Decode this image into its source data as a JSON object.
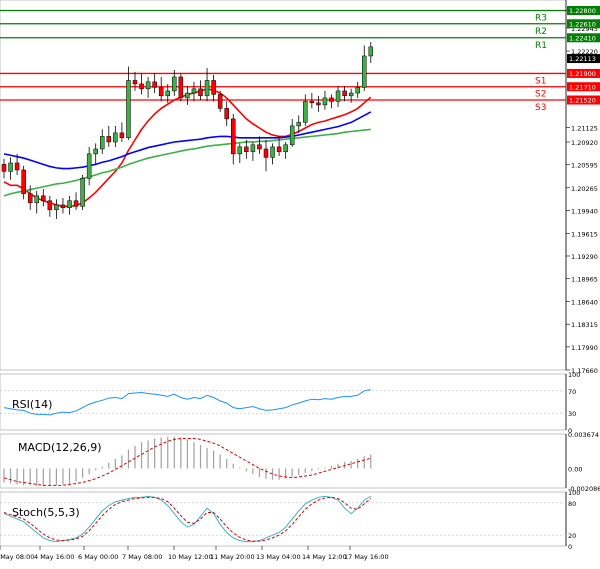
{
  "chart_data": [
    {
      "type": "candlestick",
      "panel": "price",
      "y_axis_ticks": [
        "1.22800",
        "1.22945",
        "1.22220",
        "1.21125",
        "1.20920",
        "1.20595",
        "1.20265",
        "1.19940",
        "1.19615",
        "1.19290",
        "1.18965",
        "1.18640",
        "1.18315",
        "1.17990",
        "1.17660"
      ],
      "y_axis_tick_values": [
        1.228,
        1.2255,
        1.2222,
        1.21125,
        1.2092,
        1.20595,
        1.20265,
        1.1994,
        1.19615,
        1.1929,
        1.18965,
        1.1864,
        1.18315,
        1.1799,
        1.1766
      ],
      "ylim": [
        1.1766,
        1.2295
      ],
      "current_price": "1.22113",
      "current_price_value": 1.22113,
      "levels": [
        {
          "name": "R3",
          "value": 1.228,
          "label": "1.22800",
          "color": "#008000"
        },
        {
          "name": "R2",
          "value": 1.2261,
          "label": "1.22610",
          "color": "#008000"
        },
        {
          "name": "R1",
          "value": 1.2241,
          "label": "1.22410",
          "color": "#008000"
        },
        {
          "name": "S1",
          "value": 1.219,
          "label": "1.21900",
          "color": "#ff0000"
        },
        {
          "name": "S2",
          "value": 1.2171,
          "label": "1.21710",
          "color": "#ff0000"
        },
        {
          "name": "S3",
          "value": 1.2152,
          "label": "1.21520",
          "color": "#ff0000"
        }
      ],
      "x_axis_labels": [
        "3 May 08:00",
        "4 May 16:00",
        "6 May 00:00",
        "7 May 08:00",
        "10 May 12:00",
        "11 May 20:00",
        "13 May 04:00",
        "14 May 12:00",
        "17 May 16:00"
      ],
      "candles": [
        [
          1.206,
          1.2068,
          1.204,
          1.205
        ],
        [
          1.205,
          1.207,
          1.2038,
          1.2062
        ],
        [
          1.2062,
          1.2075,
          1.2045,
          1.2052
        ],
        [
          1.2052,
          1.2058,
          1.201,
          1.2018
        ],
        [
          1.2018,
          1.203,
          1.1995,
          1.2005
        ],
        [
          1.2005,
          1.2022,
          1.199,
          1.2015
        ],
        [
          1.2015,
          1.2025,
          1.2,
          1.2008
        ],
        [
          1.2008,
          1.2015,
          1.1985,
          1.1995
        ],
        [
          1.1995,
          1.201,
          1.1982,
          1.2002
        ],
        [
          1.2002,
          1.2012,
          1.199,
          1.1998
        ],
        [
          1.1998,
          1.2015,
          1.1988,
          1.2008
        ],
        [
          1.2008,
          1.202,
          1.1995,
          1.2
        ],
        [
          1.2,
          1.2045,
          1.1995,
          1.204
        ],
        [
          1.204,
          1.2085,
          1.203,
          1.2075
        ],
        [
          1.2075,
          1.209,
          1.206,
          1.2082
        ],
        [
          1.2082,
          1.211,
          1.2075,
          1.21
        ],
        [
          1.21,
          1.2115,
          1.2085,
          1.2092
        ],
        [
          1.2092,
          1.2115,
          1.2085,
          1.2105
        ],
        [
          1.2105,
          1.212,
          1.2092,
          1.2098
        ],
        [
          1.2098,
          1.22,
          1.2095,
          1.218
        ],
        [
          1.218,
          1.2192,
          1.2165,
          1.2175
        ],
        [
          1.2175,
          1.219,
          1.216,
          1.2168
        ],
        [
          1.2168,
          1.2185,
          1.2155,
          1.2178
        ],
        [
          1.2178,
          1.219,
          1.2162,
          1.217
        ],
        [
          1.217,
          1.2185,
          1.215,
          1.2158
        ],
        [
          1.2158,
          1.2175,
          1.2148,
          1.2165
        ],
        [
          1.2165,
          1.2195,
          1.2158,
          1.2185
        ],
        [
          1.2185,
          1.219,
          1.215,
          1.2155
        ],
        [
          1.2155,
          1.2172,
          1.2145,
          1.2162
        ],
        [
          1.2162,
          1.2178,
          1.215,
          1.2168
        ],
        [
          1.2168,
          1.218,
          1.2152,
          1.2158
        ],
        [
          1.2158,
          1.2198,
          1.215,
          1.218
        ],
        [
          1.218,
          1.2188,
          1.215,
          1.216
        ],
        [
          1.216,
          1.2165,
          1.2135,
          1.214
        ],
        [
          1.214,
          1.215,
          1.2115,
          1.2125
        ],
        [
          1.2125,
          1.2132,
          1.206,
          1.2075
        ],
        [
          1.2075,
          1.209,
          1.2062,
          1.2085
        ],
        [
          1.2085,
          1.2095,
          1.2068,
          1.2078
        ],
        [
          1.2078,
          1.2092,
          1.2065,
          1.2088
        ],
        [
          1.2088,
          1.21,
          1.2075,
          1.2082
        ],
        [
          1.2082,
          1.2095,
          1.205,
          1.207
        ],
        [
          1.207,
          1.209,
          1.206,
          1.2085
        ],
        [
          1.2085,
          1.21,
          1.2072,
          1.2078
        ],
        [
          1.2078,
          1.2092,
          1.2068,
          1.2088
        ],
        [
          1.2088,
          1.2125,
          1.2085,
          1.2115
        ],
        [
          1.2115,
          1.213,
          1.2105,
          1.212
        ],
        [
          1.212,
          1.216,
          1.2115,
          1.215
        ],
        [
          1.215,
          1.2162,
          1.214,
          1.2148
        ],
        [
          1.2148,
          1.2158,
          1.2135,
          1.2145
        ],
        [
          1.2145,
          1.2165,
          1.2138,
          1.2155
        ],
        [
          1.2155,
          1.216,
          1.214,
          1.215
        ],
        [
          1.215,
          1.2172,
          1.2142,
          1.2165
        ],
        [
          1.2165,
          1.2172,
          1.215,
          1.2158
        ],
        [
          1.2158,
          1.2168,
          1.2148,
          1.2162
        ],
        [
          1.2162,
          1.2178,
          1.2155,
          1.217
        ],
        [
          1.217,
          1.223,
          1.2165,
          1.2215
        ],
        [
          1.2215,
          1.2235,
          1.2205,
          1.2228
        ]
      ],
      "moving_averages": [
        {
          "color": "#ff0000",
          "values": [
            1.2035,
            1.203,
            1.203,
            1.2025,
            1.2018,
            1.2012,
            1.2008,
            1.2005,
            1.2002,
            1.2,
            1.2,
            1.2001,
            1.2005,
            1.2012,
            1.202,
            1.203,
            1.204,
            1.205,
            1.2062,
            1.208,
            1.2095,
            1.211,
            1.2122,
            1.2132,
            1.214,
            1.2146,
            1.2152,
            1.2156,
            1.216,
            1.2162,
            1.2165,
            1.2168,
            1.2166,
            1.2162,
            1.2155,
            1.2145,
            1.2135,
            1.2125,
            1.2118,
            1.2112,
            1.2106,
            1.2102,
            1.21,
            1.21,
            1.2103,
            1.2107,
            1.2112,
            1.2117,
            1.212,
            1.2122,
            1.2125,
            1.2128,
            1.2131,
            1.2135,
            1.214,
            1.2148,
            1.2156
          ]
        },
        {
          "color": "#0000ff",
          "values": [
            1.2075,
            1.2073,
            1.2071,
            1.2069,
            1.2066,
            1.2063,
            1.206,
            1.2057,
            1.2055,
            1.2054,
            1.2054,
            1.2055,
            1.2056,
            1.2058,
            1.206,
            1.2063,
            1.2065,
            1.2068,
            1.2071,
            1.2075,
            1.2078,
            1.2081,
            1.2084,
            1.2086,
            1.2088,
            1.209,
            1.2092,
            1.2093,
            1.2094,
            1.2095,
            1.2096,
            1.2098,
            1.2099,
            1.21,
            1.21,
            1.2099,
            1.2098,
            1.2098,
            1.2098,
            1.2098,
            1.2098,
            1.2098,
            1.2098,
            1.2099,
            1.21,
            1.2102,
            1.2104,
            1.2106,
            1.2108,
            1.211,
            1.2112,
            1.2114,
            1.2117,
            1.212,
            1.2125,
            1.213,
            1.2135
          ]
        },
        {
          "color": "#3cb043",
          "values": [
            1.2015,
            1.2018,
            1.202,
            1.2022,
            1.2024,
            1.2026,
            1.2028,
            1.203,
            1.2032,
            1.2033,
            1.2035,
            1.2037,
            1.204,
            1.2042,
            1.2045,
            1.2048,
            1.205,
            1.2053,
            1.2056,
            1.206,
            1.2063,
            1.2066,
            1.2069,
            1.2071,
            1.2073,
            1.2075,
            1.2077,
            1.2079,
            1.2081,
            1.2082,
            1.2084,
            1.2086,
            1.2087,
            1.2088,
            1.2089,
            1.209,
            1.2091,
            1.2092,
            1.2092,
            1.2093,
            1.2093,
            1.2094,
            1.2095,
            1.2096,
            1.2097,
            1.2098,
            1.2099,
            1.21,
            1.2101,
            1.2102,
            1.2103,
            1.2104,
            1.2106,
            1.2107,
            1.2108,
            1.2109,
            1.211
          ]
        }
      ]
    },
    {
      "type": "line",
      "panel": "rsi",
      "title": "RSI(14)",
      "y_axis_ticks": [
        "100",
        "70",
        "30",
        "0"
      ],
      "ylim": [
        0,
        100
      ],
      "levels": [
        70,
        30
      ],
      "series": [
        {
          "color": "#1e90ff",
          "values": [
            40,
            38,
            36,
            35,
            30,
            28,
            28,
            27,
            30,
            32,
            31,
            34,
            40,
            46,
            50,
            53,
            57,
            58,
            56,
            65,
            66,
            67,
            65,
            64,
            62,
            60,
            64,
            58,
            55,
            58,
            56,
            62,
            58,
            52,
            48,
            40,
            38,
            40,
            42,
            38,
            35,
            36,
            38,
            40,
            45,
            48,
            52,
            55,
            54,
            56,
            55,
            58,
            60,
            60,
            62,
            70,
            72
          ]
        }
      ]
    },
    {
      "type": "bar",
      "panel": "macd",
      "title": "MACD(12,26,9)",
      "y_axis_ticks": [
        "0.003674",
        "0.00",
        "-0.002086"
      ],
      "ylim": [
        -0.002086,
        0.003674
      ],
      "histogram": [
        -0.0015,
        -0.0016,
        -0.0017,
        -0.0018,
        -0.0018,
        -0.0019,
        -0.0019,
        -0.0019,
        -0.0018,
        -0.0017,
        -0.0016,
        -0.0014,
        -0.001,
        -0.0006,
        -0.0002,
        0.0002,
        0.0006,
        0.001,
        0.0014,
        0.002,
        0.0024,
        0.0028,
        0.003,
        0.0032,
        0.0033,
        0.0034,
        0.0034,
        0.0033,
        0.0031,
        0.0028,
        0.0025,
        0.0022,
        0.0019,
        0.0015,
        0.001,
        0.0005,
        0.0001,
        -0.0003,
        -0.0006,
        -0.0009,
        -0.0011,
        -0.0012,
        -0.0012,
        -0.0011,
        -0.0009,
        -0.0007,
        -0.0005,
        -0.0003,
        -0.0001,
        0.0001,
        0.0003,
        0.0005,
        0.0007,
        0.0008,
        0.001,
        0.0013,
        0.0015
      ],
      "signal": [
        -0.001,
        -0.0012,
        -0.0014,
        -0.0015,
        -0.0016,
        -0.0017,
        -0.0018,
        -0.0018,
        -0.0018,
        -0.0018,
        -0.0017,
        -0.0016,
        -0.0015,
        -0.0013,
        -0.0011,
        -0.0008,
        -0.0005,
        -0.0001,
        0.0003,
        0.0007,
        0.0011,
        0.0015,
        0.0019,
        0.0023,
        0.0026,
        0.0029,
        0.0031,
        0.0032,
        0.0032,
        0.0032,
        0.0031,
        0.0029,
        0.0027,
        0.0024,
        0.002,
        0.0016,
        0.0012,
        0.0008,
        0.0004,
        0.0,
        -0.0003,
        -0.0006,
        -0.0008,
        -0.0009,
        -0.001,
        -0.0009,
        -0.0008,
        -0.0007,
        -0.0005,
        -0.0003,
        -0.0001,
        0.0001,
        0.0003,
        0.0005,
        0.0007,
        0.0009,
        0.0011
      ]
    },
    {
      "type": "line",
      "panel": "stoch",
      "title": "Stoch(5,5,3)",
      "y_axis_ticks": [
        "100",
        "80",
        "20",
        "0"
      ],
      "ylim": [
        0,
        100
      ],
      "levels": [
        80,
        20
      ],
      "series": [
        {
          "color": "#3cb4c8",
          "values": [
            60,
            55,
            50,
            45,
            35,
            25,
            15,
            10,
            8,
            10,
            12,
            15,
            22,
            35,
            50,
            65,
            75,
            82,
            85,
            88,
            90,
            90,
            92,
            90,
            85,
            75,
            60,
            45,
            35,
            40,
            55,
            70,
            60,
            40,
            25,
            15,
            10,
            8,
            8,
            10,
            15,
            20,
            25,
            35,
            50,
            65,
            78,
            85,
            90,
            92,
            90,
            85,
            70,
            60,
            70,
            85,
            92
          ]
        },
        {
          "color": "#e00000",
          "values": [
            62,
            58,
            54,
            50,
            42,
            32,
            22,
            15,
            11,
            10,
            11,
            13,
            18,
            28,
            42,
            56,
            68,
            77,
            82,
            85,
            88,
            89,
            90,
            90,
            88,
            82,
            70,
            56,
            44,
            42,
            50,
            62,
            62,
            50,
            36,
            24,
            16,
            11,
            9,
            9,
            11,
            15,
            20,
            28,
            40,
            54,
            68,
            78,
            85,
            89,
            90,
            88,
            80,
            70,
            68,
            78,
            88
          ]
        }
      ]
    }
  ],
  "price_axis": {
    "levels": [
      "1.22800",
      "1.22610",
      "1.22410",
      "1.21900",
      "1.21710",
      "1.21520"
    ]
  }
}
